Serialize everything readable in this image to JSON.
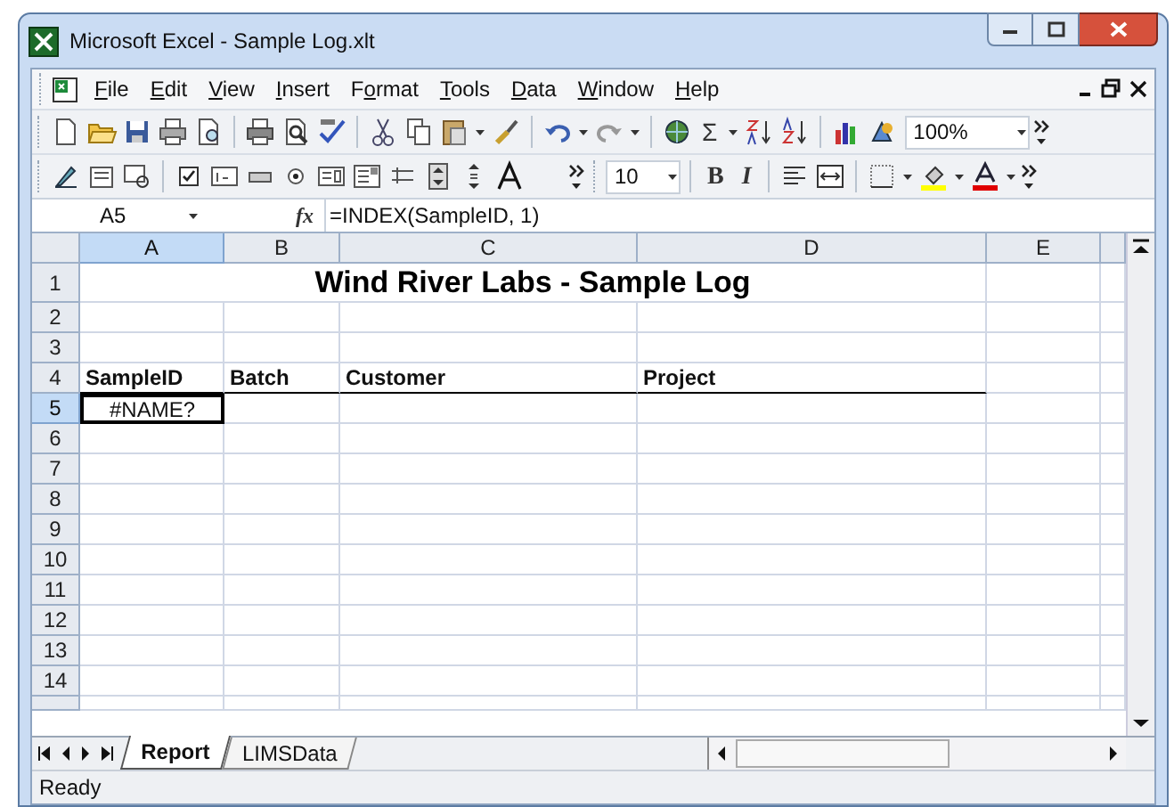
{
  "window": {
    "title": "Microsoft Excel - Sample Log.xlt"
  },
  "menu": [
    {
      "key": "F",
      "post": "ile"
    },
    {
      "key": "E",
      "post": "dit"
    },
    {
      "key": "V",
      "post": "iew"
    },
    {
      "key": "I",
      "post": "nsert"
    },
    {
      "pre": "F",
      "key": "o",
      "post": "rmat"
    },
    {
      "key": "T",
      "post": "ools"
    },
    {
      "key": "D",
      "post": "ata"
    },
    {
      "key": "W",
      "post": "indow"
    },
    {
      "key": "H",
      "post": "elp"
    }
  ],
  "toolbar": {
    "sum": "Σ",
    "zoom": "100%",
    "font_size": "10",
    "bold": "B",
    "italic": "I"
  },
  "formula_bar": {
    "name_box": "A5",
    "fx": "fx",
    "formula": "=INDEX(SampleID, 1)"
  },
  "sheet": {
    "columns": [
      {
        "label": "A",
        "selected": true
      },
      {
        "label": "B",
        "selected": false
      },
      {
        "label": "C",
        "selected": false
      },
      {
        "label": "D",
        "selected": false
      },
      {
        "label": "E",
        "selected": false
      }
    ],
    "rows": [
      {
        "label": "1",
        "selected": false
      },
      {
        "label": "2",
        "selected": false
      },
      {
        "label": "3",
        "selected": false
      },
      {
        "label": "4",
        "selected": false
      },
      {
        "label": "5",
        "selected": true
      },
      {
        "label": "6",
        "selected": false
      },
      {
        "label": "7",
        "selected": false
      },
      {
        "label": "8",
        "selected": false
      },
      {
        "label": "9",
        "selected": false
      },
      {
        "label": "10",
        "selected": false
      },
      {
        "label": "11",
        "selected": false
      },
      {
        "label": "12",
        "selected": false
      },
      {
        "label": "13",
        "selected": false
      },
      {
        "label": "14",
        "selected": false
      }
    ],
    "title": "Wind River Labs - Sample Log",
    "header_row": [
      "SampleID",
      "Batch",
      "Customer",
      "Project"
    ],
    "active_cell": {
      "value": "#NAME?"
    }
  },
  "sheet_tabs": [
    {
      "label": "Report",
      "selected": true
    },
    {
      "label": "LIMSData",
      "selected": false
    }
  ],
  "status_bar": "Ready"
}
